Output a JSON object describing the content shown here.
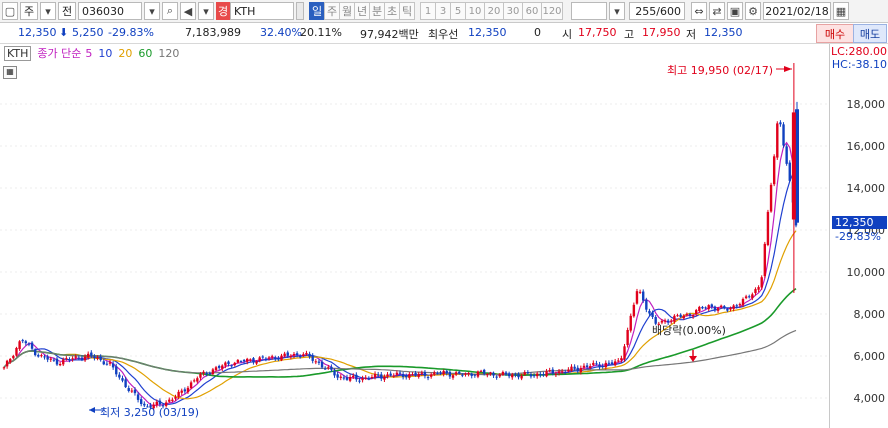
{
  "toolbar": {
    "period_label": "주",
    "code": "036030",
    "market_badge": "경",
    "stock_name": "KTH",
    "period_tabs": [
      {
        "label": "일",
        "active": true
      },
      {
        "label": "주",
        "active": false
      },
      {
        "label": "월",
        "active": false
      },
      {
        "label": "년",
        "active": false
      },
      {
        "label": "분",
        "active": false
      },
      {
        "label": "초",
        "active": false
      },
      {
        "label": "틱",
        "active": false
      }
    ],
    "intervals": [
      "1",
      "3",
      "5",
      "10",
      "20",
      "30",
      "60",
      "120"
    ],
    "count": "255/600",
    "date": "2021/02/18"
  },
  "quote": {
    "price": "12,350",
    "change": "5,250",
    "change_pct": "-29.83%",
    "volume": "7,183,989",
    "volume_pct": "32.40%",
    "turnover": "20.11%",
    "amount": "97,942백만",
    "best_bid_label": "최우선",
    "best_bid": "12,350",
    "zero": "0",
    "open_label": "시",
    "open": "17,750",
    "high_label": "고",
    "high": "17,950",
    "low_label": "저",
    "low": "12,350",
    "buy_label": "매수",
    "sell_label": "매도"
  },
  "indicator": {
    "name": "KTH",
    "type_label": "종가 단순",
    "ma": [
      {
        "period": "5",
        "color": "#c020c0"
      },
      {
        "period": "10",
        "color": "#2040d0"
      },
      {
        "period": "20",
        "color": "#e0a000"
      },
      {
        "period": "60",
        "color": "#1a9a2a"
      },
      {
        "period": "120",
        "color": "#777777"
      }
    ]
  },
  "axis": {
    "lc": "LC:280.00",
    "hc": "HC:-38.10",
    "ticks": [
      "18,000",
      "16,000",
      "14,000",
      "12,000",
      "10,000",
      "8,000",
      "6,000",
      "4,000"
    ],
    "current_price": "12,350",
    "current_pct": "-29.83%"
  },
  "annotations": {
    "high": "최고 19,950 (02/17)",
    "low": "최저 3,250 (03/19)",
    "dividend": "배당락(0.00%)"
  },
  "chart_data": {
    "type": "candlestick",
    "ylim": [
      3000,
      20500
    ],
    "current": 12350,
    "high": {
      "value": 19950,
      "date": "02/17"
    },
    "low": {
      "value": 3250,
      "date": "03/19"
    },
    "close_approx": [
      5400,
      6800,
      6000,
      5700,
      5900,
      6000,
      5600,
      4500,
      3600,
      3700,
      4200,
      5000,
      5400,
      5700,
      5800,
      5900,
      6000,
      6100,
      5600,
      5000,
      4900,
      5000,
      5100,
      5100,
      5100,
      5200,
      5100,
      5200,
      5100,
      5100,
      5100,
      5200,
      5300,
      5500,
      5600,
      5700,
      9200,
      7500,
      7800,
      8000,
      8400,
      8200,
      8600,
      9400,
      17600,
      12350
    ]
  }
}
